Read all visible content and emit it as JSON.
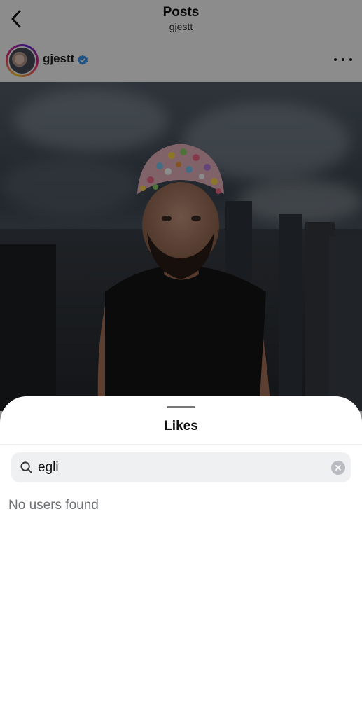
{
  "nav": {
    "title": "Posts",
    "subtitle": "gjestt"
  },
  "post": {
    "username": "gjestt",
    "verified": true,
    "colors": {
      "verified_badge": "#3897f0"
    }
  },
  "likes_sheet": {
    "title": "Likes",
    "search": {
      "value": "egli"
    },
    "empty_message": "No users found"
  },
  "icons": {
    "back": "chevron-left-icon",
    "more": "more-horizontal-icon",
    "verified": "verified-badge-icon",
    "search": "search-icon",
    "clear": "clear-icon"
  }
}
